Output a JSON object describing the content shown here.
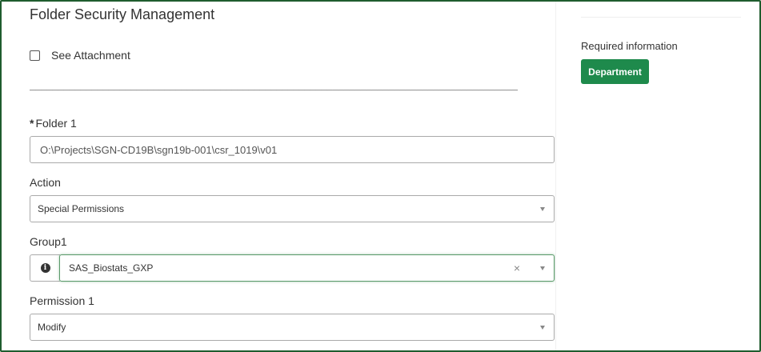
{
  "form": {
    "title": "Folder Security Management",
    "see_attachment_label": "See Attachment",
    "see_attachment_checked": false,
    "separator": "________________________________________________________________________________________",
    "folder1": {
      "required_mark": "*",
      "label": "Folder 1",
      "value": "O:\\Projects\\SGN-CD19B\\sgn19b-001\\csr_1019\\v01"
    },
    "action": {
      "label": "Action",
      "selected": "Special Permissions"
    },
    "group1": {
      "label": "Group1",
      "selected": "SAS_Biostats_GXP",
      "clear_glyph": "×",
      "info_glyph": "i"
    },
    "permission1": {
      "label": "Permission 1",
      "selected": "Modify"
    }
  },
  "sidebar": {
    "required_info_label": "Required information",
    "department_button": "Department"
  },
  "colors": {
    "frame_border": "#1f5c2e",
    "button_green": "#1e8a4c",
    "focus_border": "#5a9a6a"
  },
  "icons": {
    "info": "info-circle-icon",
    "clear": "close-icon",
    "caret": "chevron-down-icon"
  }
}
